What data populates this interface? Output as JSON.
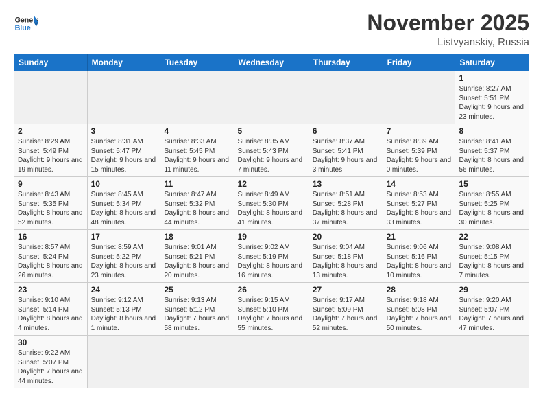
{
  "header": {
    "logo_general": "General",
    "logo_blue": "Blue",
    "title": "November 2025",
    "subtitle": "Listvyanskiy, Russia"
  },
  "weekdays": [
    "Sunday",
    "Monday",
    "Tuesday",
    "Wednesday",
    "Thursday",
    "Friday",
    "Saturday"
  ],
  "weeks": [
    [
      {
        "day": "",
        "info": ""
      },
      {
        "day": "",
        "info": ""
      },
      {
        "day": "",
        "info": ""
      },
      {
        "day": "",
        "info": ""
      },
      {
        "day": "",
        "info": ""
      },
      {
        "day": "",
        "info": ""
      },
      {
        "day": "1",
        "info": "Sunrise: 8:27 AM\nSunset: 5:51 PM\nDaylight: 9 hours and 23 minutes."
      }
    ],
    [
      {
        "day": "2",
        "info": "Sunrise: 8:29 AM\nSunset: 5:49 PM\nDaylight: 9 hours and 19 minutes."
      },
      {
        "day": "3",
        "info": "Sunrise: 8:31 AM\nSunset: 5:47 PM\nDaylight: 9 hours and 15 minutes."
      },
      {
        "day": "4",
        "info": "Sunrise: 8:33 AM\nSunset: 5:45 PM\nDaylight: 9 hours and 11 minutes."
      },
      {
        "day": "5",
        "info": "Sunrise: 8:35 AM\nSunset: 5:43 PM\nDaylight: 9 hours and 7 minutes."
      },
      {
        "day": "6",
        "info": "Sunrise: 8:37 AM\nSunset: 5:41 PM\nDaylight: 9 hours and 3 minutes."
      },
      {
        "day": "7",
        "info": "Sunrise: 8:39 AM\nSunset: 5:39 PM\nDaylight: 9 hours and 0 minutes."
      },
      {
        "day": "8",
        "info": "Sunrise: 8:41 AM\nSunset: 5:37 PM\nDaylight: 8 hours and 56 minutes."
      }
    ],
    [
      {
        "day": "9",
        "info": "Sunrise: 8:43 AM\nSunset: 5:35 PM\nDaylight: 8 hours and 52 minutes."
      },
      {
        "day": "10",
        "info": "Sunrise: 8:45 AM\nSunset: 5:34 PM\nDaylight: 8 hours and 48 minutes."
      },
      {
        "day": "11",
        "info": "Sunrise: 8:47 AM\nSunset: 5:32 PM\nDaylight: 8 hours and 44 minutes."
      },
      {
        "day": "12",
        "info": "Sunrise: 8:49 AM\nSunset: 5:30 PM\nDaylight: 8 hours and 41 minutes."
      },
      {
        "day": "13",
        "info": "Sunrise: 8:51 AM\nSunset: 5:28 PM\nDaylight: 8 hours and 37 minutes."
      },
      {
        "day": "14",
        "info": "Sunrise: 8:53 AM\nSunset: 5:27 PM\nDaylight: 8 hours and 33 minutes."
      },
      {
        "day": "15",
        "info": "Sunrise: 8:55 AM\nSunset: 5:25 PM\nDaylight: 8 hours and 30 minutes."
      }
    ],
    [
      {
        "day": "16",
        "info": "Sunrise: 8:57 AM\nSunset: 5:24 PM\nDaylight: 8 hours and 26 minutes."
      },
      {
        "day": "17",
        "info": "Sunrise: 8:59 AM\nSunset: 5:22 PM\nDaylight: 8 hours and 23 minutes."
      },
      {
        "day": "18",
        "info": "Sunrise: 9:01 AM\nSunset: 5:21 PM\nDaylight: 8 hours and 20 minutes."
      },
      {
        "day": "19",
        "info": "Sunrise: 9:02 AM\nSunset: 5:19 PM\nDaylight: 8 hours and 16 minutes."
      },
      {
        "day": "20",
        "info": "Sunrise: 9:04 AM\nSunset: 5:18 PM\nDaylight: 8 hours and 13 minutes."
      },
      {
        "day": "21",
        "info": "Sunrise: 9:06 AM\nSunset: 5:16 PM\nDaylight: 8 hours and 10 minutes."
      },
      {
        "day": "22",
        "info": "Sunrise: 9:08 AM\nSunset: 5:15 PM\nDaylight: 8 hours and 7 minutes."
      }
    ],
    [
      {
        "day": "23",
        "info": "Sunrise: 9:10 AM\nSunset: 5:14 PM\nDaylight: 8 hours and 4 minutes."
      },
      {
        "day": "24",
        "info": "Sunrise: 9:12 AM\nSunset: 5:13 PM\nDaylight: 8 hours and 1 minute."
      },
      {
        "day": "25",
        "info": "Sunrise: 9:13 AM\nSunset: 5:12 PM\nDaylight: 7 hours and 58 minutes."
      },
      {
        "day": "26",
        "info": "Sunrise: 9:15 AM\nSunset: 5:10 PM\nDaylight: 7 hours and 55 minutes."
      },
      {
        "day": "27",
        "info": "Sunrise: 9:17 AM\nSunset: 5:09 PM\nDaylight: 7 hours and 52 minutes."
      },
      {
        "day": "28",
        "info": "Sunrise: 9:18 AM\nSunset: 5:08 PM\nDaylight: 7 hours and 50 minutes."
      },
      {
        "day": "29",
        "info": "Sunrise: 9:20 AM\nSunset: 5:07 PM\nDaylight: 7 hours and 47 minutes."
      }
    ],
    [
      {
        "day": "30",
        "info": "Sunrise: 9:22 AM\nSunset: 5:07 PM\nDaylight: 7 hours and 44 minutes."
      },
      {
        "day": "",
        "info": ""
      },
      {
        "day": "",
        "info": ""
      },
      {
        "day": "",
        "info": ""
      },
      {
        "day": "",
        "info": ""
      },
      {
        "day": "",
        "info": ""
      },
      {
        "day": "",
        "info": ""
      }
    ]
  ]
}
